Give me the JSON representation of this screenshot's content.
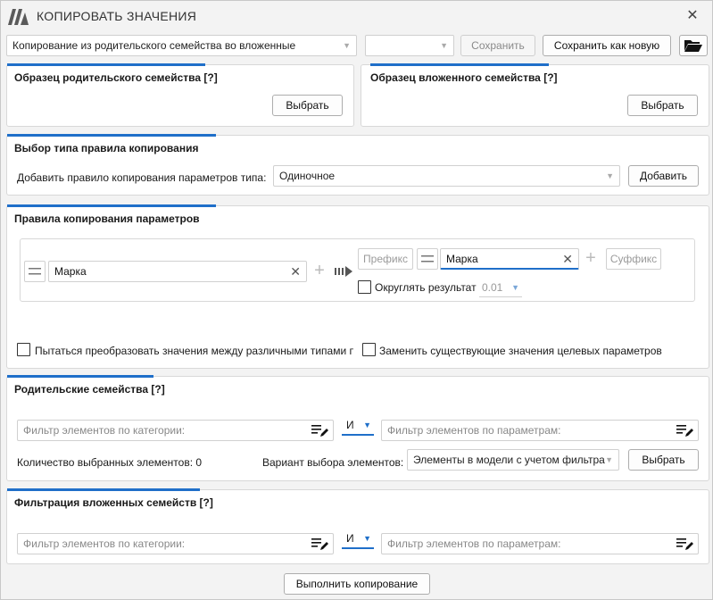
{
  "window": {
    "title": "КОПИРОВАТЬ ЗНАЧЕНИЯ"
  },
  "toolbar": {
    "preset_value": "Копирование из родительского семейства во вложенные",
    "second_combo_value": "",
    "save_label": "Сохранить",
    "save_as_new_label": "Сохранить как новую"
  },
  "parent_sample": {
    "title": "Образец родительского семейства [?]",
    "select_label": "Выбрать"
  },
  "nested_sample": {
    "title": "Образец вложенного семейства [?]",
    "select_label": "Выбрать"
  },
  "rule_type": {
    "title": "Выбор типа правила копирования",
    "add_label": "Добавить правило копирования параметров типа:",
    "type_value": "Одиночное",
    "add_button": "Добавить"
  },
  "rules": {
    "title": "Правила копирования параметров",
    "source_param": "Марка",
    "prefix_label": "Префикс",
    "target_param": "Марка",
    "suffix_label": "Суффикс",
    "round_label": "Округлять результат",
    "round_value": "0.01",
    "convert_label": "Пытаться преобразовать значения между различными типами п",
    "replace_label": "Заменить существующие значения целевых параметров"
  },
  "parent_families": {
    "title": "Родительские семейства [?]",
    "category_placeholder": "Фильтр элементов по категории:",
    "logic_value": "И",
    "param_placeholder": "Фильтр элементов по параметрам:",
    "count_label": "Количество выбранных элементов: 0",
    "variant_label": "Вариант выбора элементов:",
    "variant_value": "Элементы в модели с учетом фильтра",
    "select_label": "Выбрать"
  },
  "nested_families": {
    "title": "Фильтрация вложенных семейств [?]",
    "category_placeholder": "Фильтр элементов по категории:",
    "logic_value": "И",
    "param_placeholder": "Фильтр элементов по параметрам:"
  },
  "footer": {
    "run_label": "Выполнить копирование"
  },
  "colors": {
    "accent": "#1f6fc9",
    "logo": "#5a5a5a"
  },
  "icons": [
    "logo-icon",
    "close-icon",
    "folder-open-icon",
    "clear-icon",
    "plus-icon",
    "arrow-right-icon",
    "filter-edit-icon",
    "chevron-down-icon",
    "drag-handle-icon"
  ]
}
